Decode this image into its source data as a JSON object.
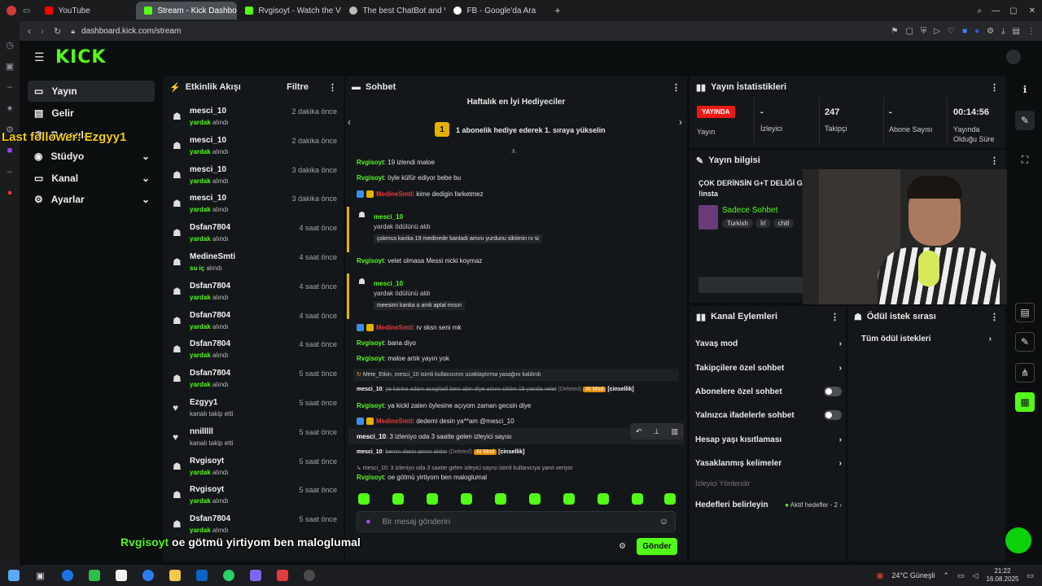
{
  "browser": {
    "tabs": [
      {
        "label": "YouTube",
        "color": "#ff0000"
      },
      {
        "label": "Stream - Kick Dashboard",
        "color": "#53fc18"
      },
      {
        "label": "Rvgisoyt - Watch the VOD",
        "color": "#53fc18"
      },
      {
        "label": "The best ChatBot and Wi",
        "color": "#bbbbbb"
      },
      {
        "label": "FB - Google'da Ara",
        "color": "#ffffff"
      }
    ],
    "url": "dashboard.kick.com/stream"
  },
  "sidebar": {
    "items": [
      {
        "label": "Yayın",
        "icon": "broadcast-icon"
      },
      {
        "label": "Gelir",
        "icon": "money-icon"
      },
      {
        "label": "Başarılar",
        "icon": "trophy-icon"
      },
      {
        "label": "Stüdyo",
        "icon": "studio-icon"
      },
      {
        "label": "Kanal",
        "icon": "channel-icon"
      },
      {
        "label": "Ayarlar",
        "icon": "settings-icon"
      }
    ]
  },
  "overlay": {
    "last_follower": "Last follower: Ezgyy1",
    "caption_user": "Rvgisoyt",
    "caption_text": "oe götmü yirtiyom ben maloglumal"
  },
  "activity": {
    "title": "Etkinlik Akışı",
    "filter": "Filtre",
    "events": [
      {
        "name": "mesci_10",
        "action": "yardak",
        "suffix": "alındı",
        "time": "2 dakika önce"
      },
      {
        "name": "mesci_10",
        "action": "yardak",
        "suffix": "alındı",
        "time": "2 dakika önce"
      },
      {
        "name": "mesci_10",
        "action": "yardak",
        "suffix": "alındı",
        "time": "3 dakika önce"
      },
      {
        "name": "mesci_10",
        "action": "yardak",
        "suffix": "alındı",
        "time": "3 dakika önce"
      },
      {
        "name": "Dsfan7804",
        "action": "yardak",
        "suffix": "alındı",
        "time": "4 saat önce"
      },
      {
        "name": "MedineSmti",
        "action": "su iç",
        "suffix": "alındı",
        "time": "4 saat önce"
      },
      {
        "name": "Dsfan7804",
        "action": "yardak",
        "suffix": "alındı",
        "time": "4 saat önce"
      },
      {
        "name": "Dsfan7804",
        "action": "yardak",
        "suffix": "alındı",
        "time": "4 saat önce"
      },
      {
        "name": "Dsfan7804",
        "action": "yardak",
        "suffix": "alındı",
        "time": "4 saat önce"
      },
      {
        "name": "Dsfan7804",
        "action": "yardak",
        "suffix": "alındı",
        "time": "5 saat önce"
      },
      {
        "name": "Ezgyy1",
        "action": "",
        "suffix": "kanalı takip etti",
        "time": "5 saat önce"
      },
      {
        "name": "nnilllll",
        "action": "",
        "suffix": "kanalı takip etti",
        "time": "5 saat önce"
      },
      {
        "name": "Rvgisoyt",
        "action": "yardak",
        "suffix": "alındı",
        "time": "5 saat önce"
      },
      {
        "name": "Rvgisoyt",
        "action": "yardak",
        "suffix": "alındı",
        "time": "5 saat önce"
      },
      {
        "name": "Dsfan7804",
        "action": "yardak",
        "suffix": "alındı",
        "time": "5 saat önce"
      }
    ]
  },
  "chat": {
    "title": "Sohbet",
    "gifters_title": "Haftalık en İyi Hediyeciler",
    "gifters_rank": "1",
    "gifters_text": "1 abonelik hediye ederek 1. sıraya yükselin",
    "input_placeholder": "Bir mesaj gönderin",
    "send_label": "Gönder",
    "m1_user": "Rvgisoyt",
    "m1_text": ": 19 izlendi maloe",
    "m2_user": "Rvgisoyt",
    "m2_text": ": öyle küfür ediyor bebe bu",
    "m3_user": "MedineSmti",
    "m3_text": ": kime dedigin farketmez",
    "r1_user": "mesci_10",
    "r1_sub": "yardak ödülünü aldı",
    "r1_quote": "çokmus kanka 19 medinede banladı amını yurdunu siktimin rv si",
    "m4_user": "Rvgisoyt",
    "m4_text": ": velet olmasa Messi nicki koymaz",
    "r2_user": "mesci_10",
    "r2_sub": "yardak ödülünü aldı",
    "r2_quote": "meesimi kanka o amk aptal mısın",
    "m5_user": "MedineSmti",
    "m5_text": ": rv sksn seni mk",
    "m6_user": "Rvgisoyt",
    "m6_text": ": bana diyo",
    "m7_user": "Rvgisoyt",
    "m7_text": ": maloe artık yayın yok",
    "sys1": "Mete_Etkin, mesci_10 isimli kullanıcının uzaklaştırma yasağını kaldırdı",
    "m8_user": "mesci_10",
    "m8_text": "ya kanka adam asagiladi beni abin diye amını siktim 19 yasida velet",
    "deleted": "(Deleted)",
    "aimod": "AI Mod",
    "cinsellik": "[cinsellik]",
    "m9_user": "Rvgisoyt",
    "m9_text": ": ya kickl zaten öylesine açıyom zaman gecsin diye",
    "m10_user": "MedineSmti",
    "m10_text": ": dedemi desin ya**am @mesci_10",
    "m11_user": "mesci_10",
    "m11_text": ": 3 izleniyo oda 3 saatte gelen izleyici sayısı",
    "m12_user": "mesci_10",
    "m12_text": "benim desin amını aktim",
    "sys2": "mesci_10: 3 izleniyo oda 3 saatte gelen izleyici sayısı isimli kullanıcıya yanıt veriyor",
    "m13_user": "Rvgisoyt",
    "m13_text": ": oe götmü yirtiyom ben maloglumal"
  },
  "stats": {
    "title": "Yayın İstatistikleri",
    "live_badge": "YAYINDA",
    "live_label": "Yayın",
    "viewers_value": "-",
    "viewers_label": "İzleyici",
    "followers_value": "247",
    "followers_label": "Takipçi",
    "subs_value": "-",
    "subs_label": "Abone Sayısı",
    "uptime_value": "00:14:56",
    "uptime_label": "Yayında Olduğu Süre"
  },
  "stream_info": {
    "title": "Yayın bilgisi",
    "stream_title": "ÇOK DERİNSİN G+T DELİĞİ G",
    "hashtag": "!insta",
    "category": "Sadece Sohbet",
    "tags": [
      "Turkish",
      "İrl",
      "chill"
    ]
  },
  "channel_actions": {
    "title": "Kanal Eylemleri",
    "items": [
      {
        "label": "Yavaş mod"
      },
      {
        "label": "Takipçilere özel sohbet"
      },
      {
        "label": "Abonelere özel sohbet"
      },
      {
        "label": "Yalnızca ifadelerle sohbet"
      },
      {
        "label": "Hesap yaşı kısıtlaması"
      },
      {
        "label": "Yasaklanmış kelimeler"
      }
    ],
    "redirect_label": "İzleyici Yönlendir",
    "goals_label": "Hedefleri belirleyin",
    "goals_status": "Aktif hedefler - 2"
  },
  "rewards": {
    "title": "Ödül istek sırası",
    "all_label": "Tüm ödül istekleri"
  },
  "taskbar": {
    "weather": "24°C  Güneşli",
    "time": "21:22",
    "date": "16.08.2025",
    "app_colors": [
      "#1a73e8",
      "#2cc04a",
      "#f2f2f2",
      "#2a7cf3",
      "#f2c94c",
      "#0a64c8",
      "#25d366",
      "#7b68ee",
      "#e53b3b",
      "#4a4a4a"
    ]
  },
  "colors": {
    "kick_green": "#53fc18",
    "live_red": "#e91916",
    "panel_bg": "#141719"
  }
}
